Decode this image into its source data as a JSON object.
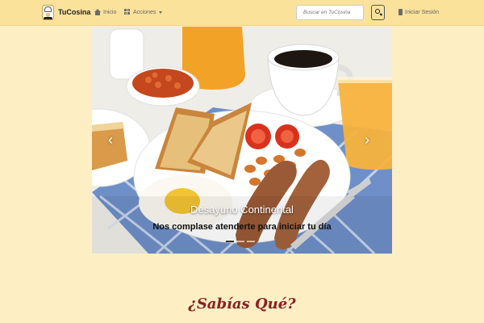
{
  "navbar": {
    "brand": "TuCosina",
    "home_label": "Inicio",
    "actions_label": "Acciones",
    "login_label": "Iniciar Sesión",
    "search_placeholder": "Buscar en TuCosina"
  },
  "carousel": {
    "slide_title": "Desayuno Continental",
    "slide_subtitle": "Nos complase atenderte para iniciar tu día",
    "indicator_count": 3,
    "active_index": 0
  },
  "section": {
    "title": "¿Sabías Qué?"
  },
  "colors": {
    "page_bg": "#fdeec4",
    "navbar_bg": "#fbe29b",
    "section_title": "#8b2020"
  }
}
